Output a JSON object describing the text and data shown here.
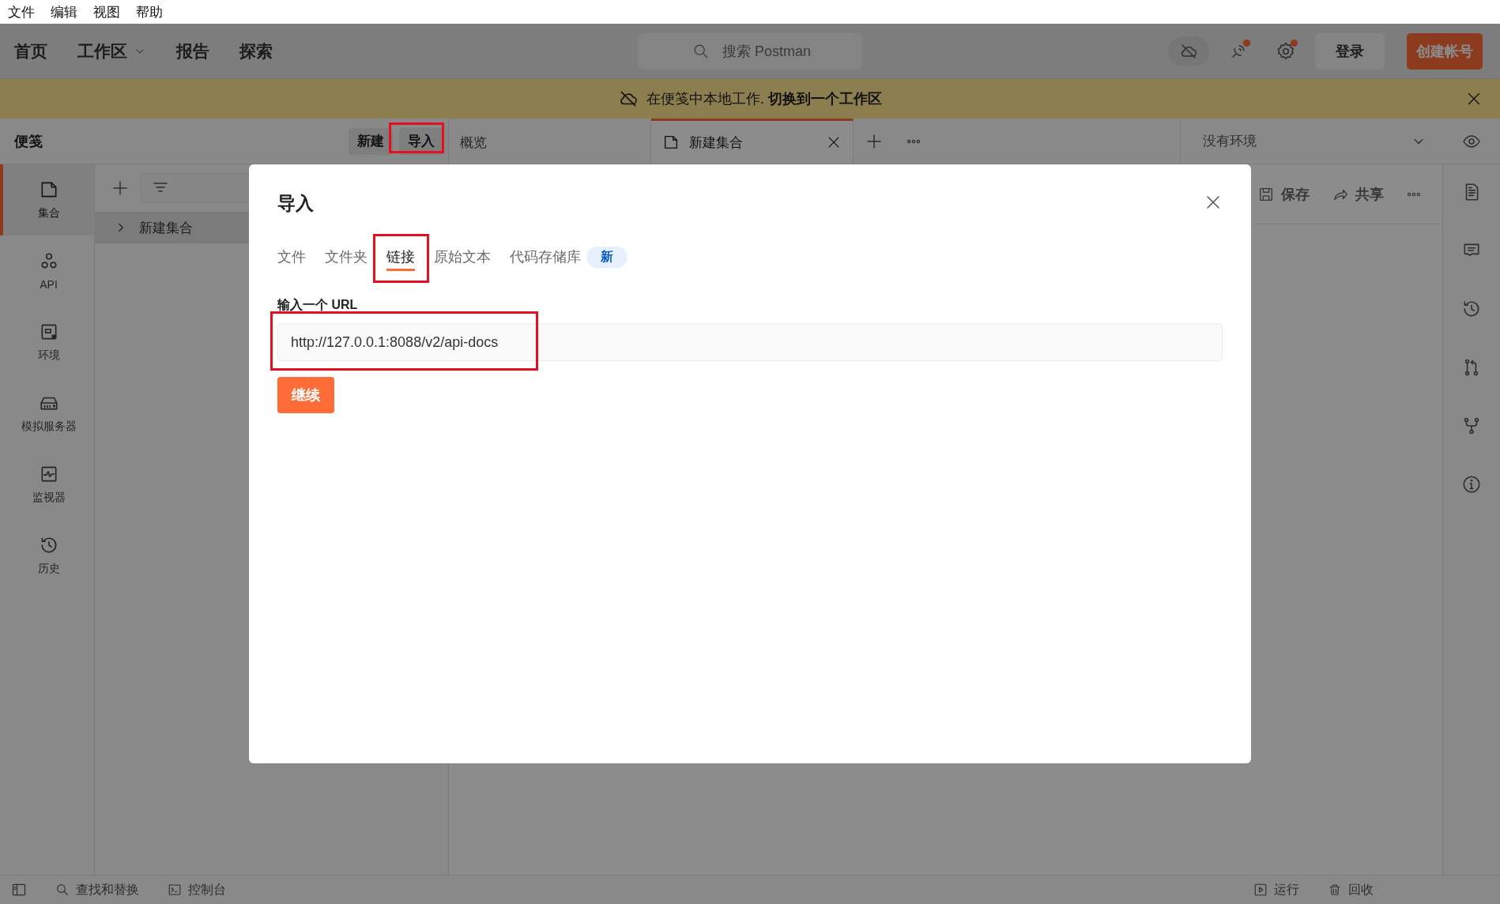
{
  "menu_bar": {
    "items": [
      "文件",
      "编辑",
      "视图",
      "帮助"
    ]
  },
  "header": {
    "nav": [
      {
        "label": "首页",
        "has_menu": false
      },
      {
        "label": "工作区",
        "has_menu": true
      },
      {
        "label": "报告",
        "has_menu": false
      },
      {
        "label": "探索",
        "has_menu": false
      }
    ],
    "search": {
      "placeholder": "搜索 Postman"
    },
    "sign_in": "登录",
    "create_account": "创建帐号"
  },
  "banner": {
    "text": "在便笺中本地工作. **切换到一个工作区**"
  },
  "scratchpad": {
    "title": "便笺",
    "buttons": [
      "新建",
      "导入"
    ]
  },
  "tabs": [
    {
      "label": "概览",
      "kind": "overview",
      "selected": false
    },
    {
      "label": "新建集合",
      "kind": "collection",
      "selected": true
    }
  ],
  "environment": {
    "value": "没有环境"
  },
  "sidebar": {
    "items": [
      {
        "label": "集合",
        "selected": true
      },
      {
        "label": "API",
        "selected": false
      },
      {
        "label": "环境",
        "selected": false
      },
      {
        "label": "模拟服务器",
        "selected": false
      },
      {
        "label": "监视器",
        "selected": false
      },
      {
        "label": "历史",
        "selected": false
      }
    ]
  },
  "collections": {
    "items": [
      {
        "label": "新建集合",
        "selected": true,
        "expanded": false
      }
    ]
  },
  "request_toolbar": {
    "actions": [
      "保存",
      "共享"
    ]
  },
  "status_bar": {
    "left": [
      "查找和替换",
      "控制台"
    ],
    "right": [
      "运行",
      "回收"
    ]
  },
  "dialog": {
    "title": "导入",
    "tabs": [
      {
        "label": "文件",
        "selected": false
      },
      {
        "label": "文件夹",
        "selected": false
      },
      {
        "label": "链接",
        "selected": true
      },
      {
        "label": "原始文本",
        "selected": false
      },
      {
        "label": "代码存储库",
        "selected": false,
        "badge": "新"
      }
    ],
    "url_label": "输入一个 URL",
    "url_field": {
      "value": "http://127.0.0.1:8088/v2/api-docs"
    },
    "continue_button": "继续"
  }
}
